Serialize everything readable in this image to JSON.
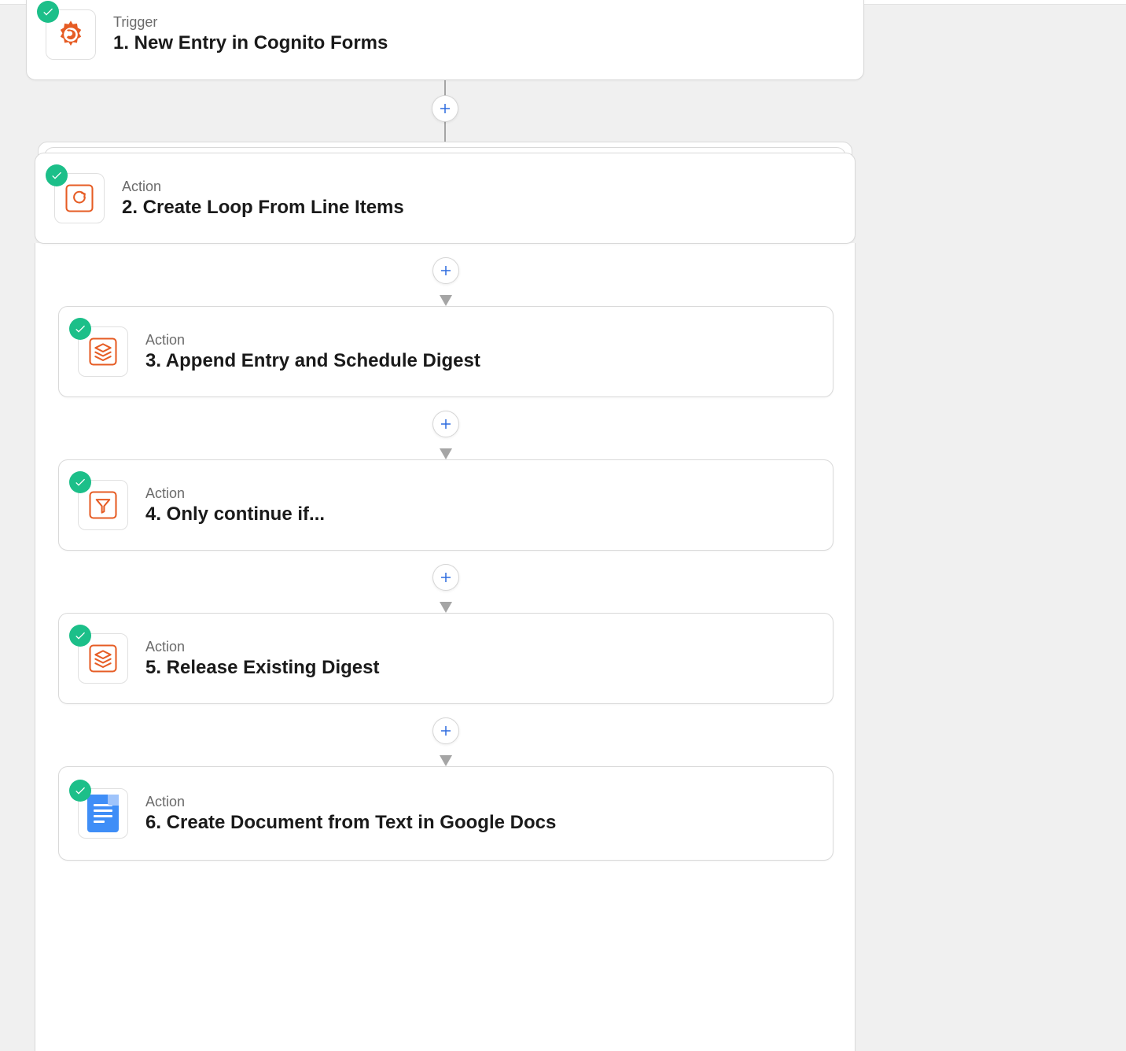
{
  "colors": {
    "accent_success": "#1cbf89",
    "accent_plus": "#2d6bdf",
    "brand_orange": "#e65c24",
    "brand_gdocs": "#3f8ef7"
  },
  "steps": [
    {
      "id": 1,
      "type_label": "Trigger",
      "title": "1. New Entry in Cognito Forms",
      "icon": "cognito-gear",
      "checked": true
    },
    {
      "id": 2,
      "type_label": "Action",
      "title": "2. Create Loop From Line Items",
      "icon": "loop",
      "checked": true
    },
    {
      "id": 3,
      "type_label": "Action",
      "title": "3. Append Entry and Schedule Digest",
      "icon": "digest-stack",
      "checked": true
    },
    {
      "id": 4,
      "type_label": "Action",
      "title": "4. Only continue if...",
      "icon": "filter",
      "checked": true
    },
    {
      "id": 5,
      "type_label": "Action",
      "title": "5. Release Existing Digest",
      "icon": "digest-stack",
      "checked": true
    },
    {
      "id": 6,
      "type_label": "Action",
      "title": "6. Create Document from Text in Google Docs",
      "icon": "google-docs",
      "checked": true
    }
  ]
}
